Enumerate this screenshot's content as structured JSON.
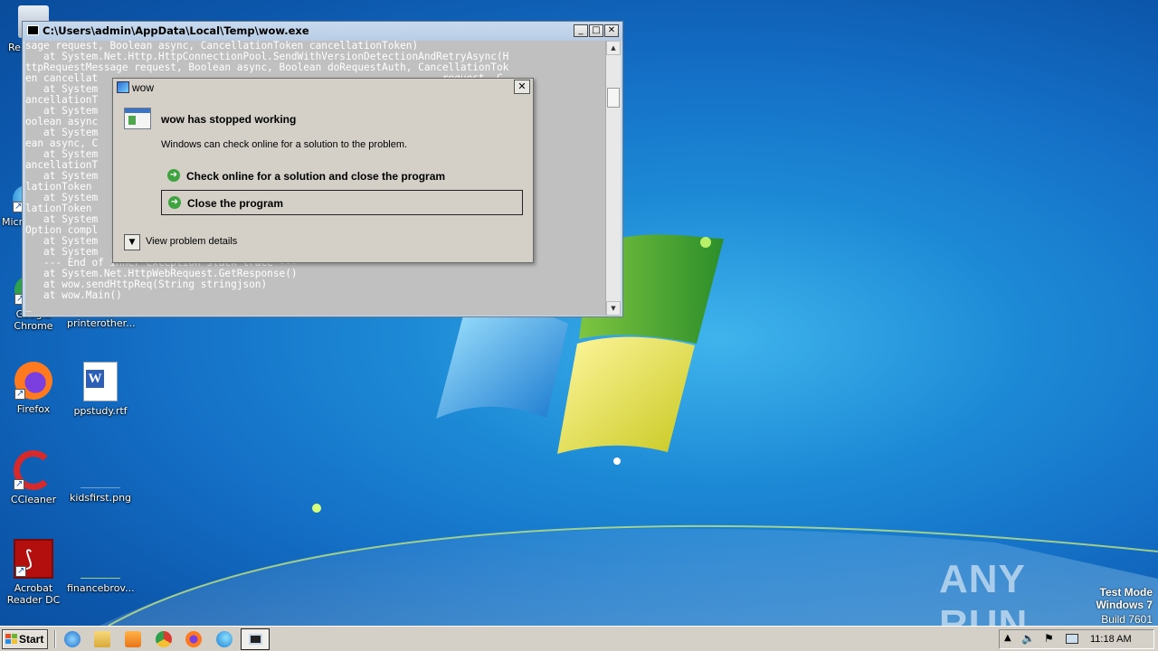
{
  "desktop": {
    "icons": [
      {
        "label": "Re",
        "kind": "recycle"
      },
      {
        "label": "Micr",
        "kind": "edge"
      },
      {
        "label": "Google Chrome",
        "kind": "chrome"
      },
      {
        "label": "printerother...",
        "kind": "blank"
      },
      {
        "label": "Firefox",
        "kind": "firefox"
      },
      {
        "label": "ppstudy.rtf",
        "kind": "word"
      },
      {
        "label": "CCleaner",
        "kind": "ccleaner"
      },
      {
        "label": "kidsfirst.png",
        "kind": "blank"
      },
      {
        "label": "Acrobat Reader DC",
        "kind": "acrobat"
      },
      {
        "label": "financebrov...",
        "kind": "blank"
      }
    ]
  },
  "console": {
    "title": "C:\\Users\\admin\\AppData\\Local\\Temp\\wow.exe",
    "buttons": {
      "minimize": "_",
      "maximize": "□",
      "close": "✕"
    },
    "lines": [
      "sage request, Boolean async, CancellationToken cancellationToken)",
      "   at System.Net.Http.HttpConnectionPool.SendWithVersionDetectionAndRetryAsync(H",
      "ttpRequestMessage request, Boolean async, Boolean doRequestAuth, CancellationTok",
      "en cancellat                                                         request, C",
      "   at System                                                         ancellatio",
      "ancellationT                                                         request, B",
      "   at System                                                         ",
      "oolean async                                                         uest, Bool",
      "   at System                                                         ",
      "ean async, C                                                         st, Cancel",
      "   at System                                                         ",
      "ancellationT                                                         st, Cancel",
      "   at System                                                         Completion",
      "lationToken                                                          ",
      "   at System                                                         ",
      "lationToken                                                          ",
      "   at System                                                         ",
      "Option compl                                                         ",
      "   at System                                                         ",
      "   at System                                                         ",
      "   --- End of inner exception stack trace ---",
      "   at System.Net.HttpWebRequest.GetResponse()",
      "   at wow.sendHttpReq(String stringjson)",
      "   at wow.Main()",
      "_"
    ]
  },
  "dialog": {
    "title": "wow",
    "close": "✕",
    "heading": "wow has stopped working",
    "subtext": "Windows can check online for a solution to the problem.",
    "option_check": "Check online for a solution and close the program",
    "option_close": "Close the program",
    "details": "View problem details"
  },
  "watermark": {
    "brand": "ANY RUN",
    "line1": "Test Mode",
    "line2": "Windows 7",
    "line3": "Build 7601"
  },
  "taskbar": {
    "start": "Start",
    "clock": "11:18 AM",
    "pinned": [
      "ie-icon",
      "explorer-icon",
      "media-player-icon",
      "chrome-icon",
      "firefox-icon",
      "edge-icon"
    ]
  }
}
